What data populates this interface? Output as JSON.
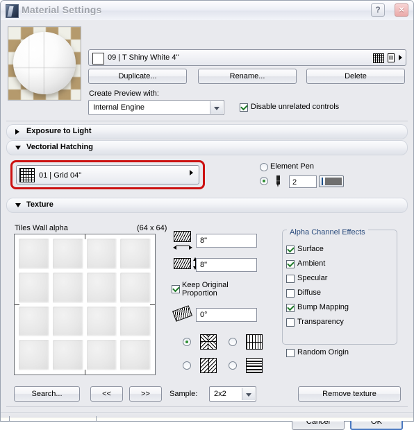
{
  "window": {
    "title": "Material Settings",
    "icon": "app-icon",
    "help_label": "?",
    "close_label": "×"
  },
  "material": {
    "name": "09 | T Shiny White 4\"",
    "swatch_color": "#ffffff",
    "icons": [
      "grid-icon",
      "document-icon",
      "expand-arrow-icon"
    ],
    "buttons": {
      "duplicate": "Duplicate...",
      "rename": "Rename...",
      "delete": "Delete"
    },
    "create_preview_label": "Create Preview with:",
    "engine": {
      "value": "Internal Engine",
      "options": [
        "Internal Engine"
      ]
    },
    "disable_unrelated": {
      "label": "Disable unrelated controls",
      "checked": true
    }
  },
  "sections": {
    "exposure": {
      "label": "Exposure to Light",
      "expanded": false
    },
    "hatching": {
      "label": "Vectorial Hatching",
      "expanded": true
    },
    "texture": {
      "label": "Texture",
      "expanded": true
    }
  },
  "hatching": {
    "selected_hatch": "01 | Grid 04\"",
    "highlight_color": "#cc1111",
    "element_pen": {
      "label": "Element Pen",
      "selected": false
    },
    "custom_pen": {
      "selected": true,
      "pen_number": "2"
    }
  },
  "texture": {
    "name": "Tiles Wall alpha",
    "dimensions": "(64 x 64)",
    "width_value": "8\"",
    "height_value": "8\"",
    "keep_proportion": {
      "label": "Keep Original Proportion",
      "checked": true
    },
    "angle_value": "0°",
    "mirror_options": [
      {
        "name": "pattern-normal",
        "selected": true
      },
      {
        "name": "pattern-mirror-x",
        "selected": false
      },
      {
        "name": "pattern-mirror-y",
        "selected": false
      },
      {
        "name": "pattern-mirror-xy",
        "selected": false
      }
    ],
    "alpha_effects": {
      "title": "Alpha Channel Effects",
      "items": [
        {
          "label": "Surface",
          "checked": true
        },
        {
          "label": "Ambient",
          "checked": true
        },
        {
          "label": "Specular",
          "checked": false
        },
        {
          "label": "Diffuse",
          "checked": false
        },
        {
          "label": "Bump Mapping",
          "checked": true
        },
        {
          "label": "Transparency",
          "checked": false
        }
      ]
    },
    "random_origin": {
      "label": "Random Origin",
      "checked": false
    },
    "buttons": {
      "search": "Search...",
      "prev": "<<",
      "next": ">>",
      "remove": "Remove texture"
    },
    "sample": {
      "label": "Sample:",
      "value": "2x2",
      "options": [
        "2x2"
      ]
    }
  },
  "dialog_buttons": {
    "cancel": "Cancel",
    "ok": "OK"
  }
}
